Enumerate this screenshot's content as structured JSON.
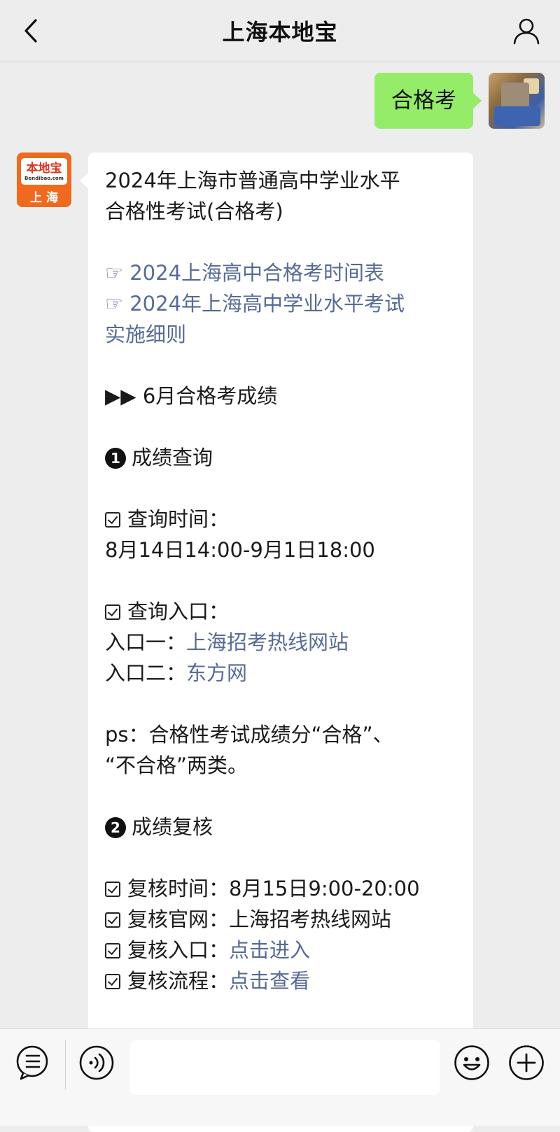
{
  "header": {
    "title": "上海本地宝",
    "back_icon": "chevron-left-icon",
    "profile_icon": "person-icon"
  },
  "sent_message": {
    "text": "合格考"
  },
  "bot_avatar": {
    "brand": "本地宝",
    "site": "Bendibao.com",
    "city": "上 海"
  },
  "message": {
    "title_line1": "2024年上海市普通高中学业水平",
    "title_line2": "合格性考试(合格考)",
    "link1": "☞ 2024上海高中合格考时间表",
    "link2_line1": "☞ 2024年上海高中学业水平考试",
    "link2_line2": "实施细则",
    "section_heading": "▶▶ 6月合格考成绩",
    "step1_num": "1",
    "step1_title": "成绩查询",
    "query_time_label": "查询时间：",
    "query_time_value": "8月14日14:00-9月1日18:00",
    "query_entry_label": "查询入口：",
    "entry1_label": "入口一：",
    "entry1_link": "上海招考热线网站",
    "entry2_label": "入口二：",
    "entry2_link": "东方网",
    "ps_line1": "ps：合格性考试成绩分“合格”、",
    "ps_line2": "“不合格”两类。",
    "step2_num": "2",
    "step2_title": "成绩复核",
    "review_time_label": "复核时间：",
    "review_time_value": "8月15日9:00-20:00",
    "review_site_label": "复核官网：",
    "review_site_value": "上海招考热线网站",
    "review_entry_label": "复核入口：",
    "review_entry_link": "点击进入",
    "review_flow_label": "复核流程：",
    "review_flow_link": "点击查看"
  },
  "bottom_bar": {
    "menu_icon": "list-menu-icon",
    "voice_icon": "voice-icon",
    "input_value": "",
    "emoji_icon": "emoji-icon",
    "plus_icon": "plus-icon"
  },
  "colors": {
    "link": "#576b95",
    "sent_bubble": "#95ec69",
    "background": "#ededed"
  }
}
